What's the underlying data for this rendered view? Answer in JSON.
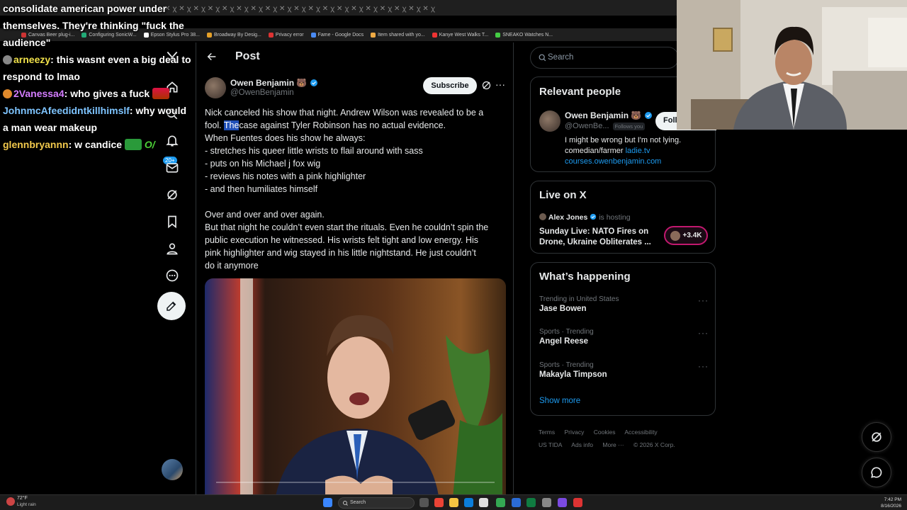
{
  "browser": {
    "bookmarks": [
      "Canvas Beer plug-i...",
      "Configuring SonicW...",
      "Epson Stylus Pro 38...",
      "Broadway By Desig...",
      "Privacy error",
      "Fame - Google Docs",
      "Item shared with yo...",
      "Kanye West Walks T...",
      "SNEAKO Watches N..."
    ]
  },
  "chat": {
    "messages": [
      {
        "user": "",
        "text": "consolidate american power under themselves. They're thinking \"fuck the audience\"",
        "color": "#ffffff"
      },
      {
        "user": "arneezy",
        "text": "this wasnt even a big deal to respond to lmao",
        "color": "#f0e14a"
      },
      {
        "user": "2Vanessa4",
        "text": "who gives a fuck",
        "color": "#d47dff"
      },
      {
        "user": "JohnmcAfeedidntkillhimslf",
        "text": "why would a man wear makeup",
        "color": "#7ec4ff"
      },
      {
        "user": "glennbryannn",
        "text": "w candice",
        "color": "#f2c94c"
      }
    ]
  },
  "nav": {
    "notif_badge": "20+"
  },
  "post": {
    "header_title": "Post",
    "author_name": "Owen Benjamin",
    "author_emoji": "🐻",
    "author_handle": "@OwenBenjamin",
    "subscribe_label": "Subscribe",
    "text_lines": [
      "Nick canceled his show that night. Andrew Wilson was revealed to be a",
      "fool. ",
      "When Fuentes does his show he always:",
      "- stretches his queer little wrists to flail around with sass",
      "- puts on his Michael j fox wig",
      "- reviews his notes with a pink highlighter",
      "- and then humiliates himself",
      "",
      "Over and over and over again.",
      "But that night he couldn’t even start the rituals. Even he couldn’t spin the",
      "public execution he witnessed. His wrists felt tight and low energy. His",
      "pink highlighter and wig stayed in his little nightstand. He just couldn’t",
      "do it anymore"
    ],
    "highlighted_word": "The",
    "line2_rest": "case against Tyler Robinson has no actual evidence."
  },
  "sidebar": {
    "search_placeholder": "Search",
    "relevant_people": {
      "title": "Relevant people",
      "name": "Owen Benjamin",
      "emoji": "🐻",
      "handle": "@OwenBe...",
      "follows_you": "Follows you",
      "follow_label": "Foll",
      "bio_line1": "I might be wrong but I'm not lying.",
      "bio_line2_prefix": "comedian/farmer ",
      "bio_link1": "ladie.tv",
      "bio_link2": "courses.owenbenjamin.com"
    },
    "live": {
      "title": "Live on X",
      "host": "Alex Jones",
      "hosting_label": "is hosting",
      "line1": "Sunday Live: NATO Fires on",
      "line2": "Drone, Ukraine Obliterates ...",
      "count": "+3.4K"
    },
    "happening": {
      "title": "What’s happening",
      "trends": [
        {
          "context": "Trending in United States",
          "topic": "Jase Bowen"
        },
        {
          "context": "Sports · Trending",
          "topic": "Angel Reese"
        },
        {
          "context": "Sports · Trending",
          "topic": "Makayla Timpson"
        }
      ],
      "show_more": "Show more"
    },
    "footer": [
      "Terms",
      "Privacy",
      "Cookies",
      "Accessibility",
      "US TIDA",
      "Ads info",
      "More ···",
      "© 2026 X Corp."
    ]
  },
  "taskbar": {
    "temp": "72°F",
    "weather": "Light rain",
    "search": "Search",
    "time": "7:42 PM",
    "date": "8/16/2026"
  },
  "colors": {
    "accent": "#1d9bf0",
    "border": "#2f3336",
    "muted": "#71767b",
    "live_ring": "#c2186f"
  }
}
